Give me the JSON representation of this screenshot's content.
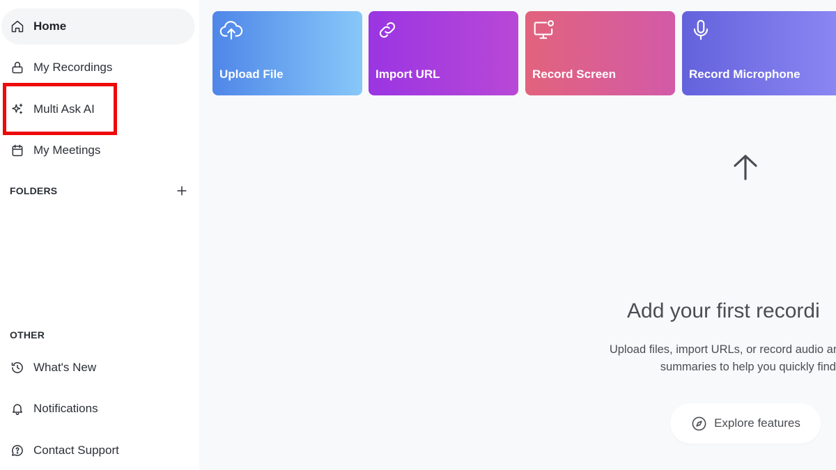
{
  "sidebar": {
    "nav": [
      {
        "label": "Home",
        "icon": "home-icon",
        "active": true
      },
      {
        "label": "My Recordings",
        "icon": "lock-icon"
      },
      {
        "label": "Multi Ask AI",
        "icon": "sparkle-icon"
      },
      {
        "label": "My Meetings",
        "icon": "calendar-icon"
      }
    ],
    "folders_label": "FOLDERS",
    "other_label": "OTHER",
    "other": [
      {
        "label": "What's New",
        "icon": "history-icon"
      },
      {
        "label": "Notifications",
        "icon": "bell-icon"
      },
      {
        "label": "Contact Support",
        "icon": "support-chat-icon"
      }
    ],
    "highlight_color": "#ee0a0a"
  },
  "actions": [
    {
      "label": "Upload File",
      "icon": "cloud-upload-icon"
    },
    {
      "label": "Import URL",
      "icon": "link-icon"
    },
    {
      "label": "Record Screen",
      "icon": "monitor-record-icon"
    },
    {
      "label": "Record Microphone",
      "icon": "microphone-icon"
    }
  ],
  "empty_state": {
    "title": "Add your first recordi",
    "description_line1": "Upload files, import URLs, or record audio and screen directly",
    "description_line2": "summaries to help you quickly find what y",
    "explore_label": "Explore features",
    "explore_icon": "compass-icon"
  },
  "colors": {
    "upload": [
      "#4f86e8",
      "#87c8f9"
    ],
    "import": [
      "#9a35e2",
      "#b848d6"
    ],
    "screen": [
      "#e2637d",
      "#d25aa8"
    ],
    "mic": [
      "#6462dc",
      "#8a86f2"
    ]
  }
}
